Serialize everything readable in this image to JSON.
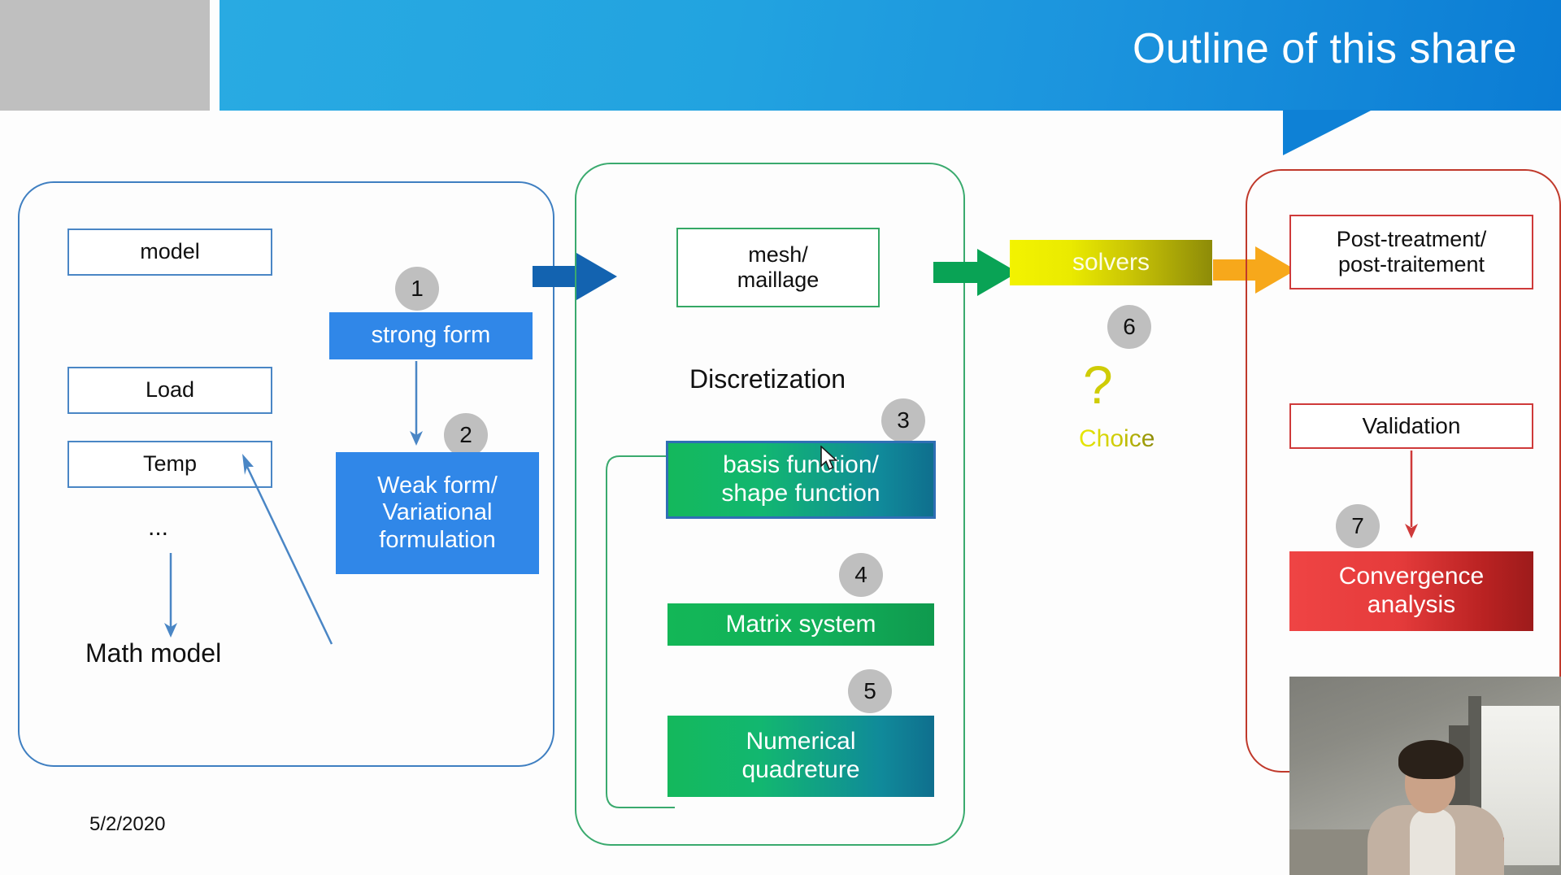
{
  "header": {
    "title": "Outline of this share"
  },
  "footer": {
    "date": "5/2/2020"
  },
  "colors": {
    "header_blue": "#1b93dd",
    "panel_blue": "#3f7fc1",
    "panel_green": "#3aaa6e",
    "panel_red": "#c0392b",
    "fill_blue": "#3087e8",
    "fill_green": "#13b757",
    "fill_yellow": "#eaea00",
    "fill_red": "#e53b3b",
    "badge_gray": "#bfbfbf",
    "selection_blue": "#2f6fb5"
  },
  "left_panel": {
    "inputs": [
      {
        "label": "model"
      },
      {
        "label": "Load"
      },
      {
        "label": "Temp"
      }
    ],
    "ellipsis": "...",
    "math_model": "Math model",
    "steps": [
      {
        "number": "1",
        "label": "strong form"
      },
      {
        "number": "2",
        "label": "Weak form/\nVariational\nformulation"
      }
    ]
  },
  "middle_panel": {
    "mesh": "mesh/\nmaillage",
    "discretization": "Discretization",
    "steps": [
      {
        "number": "3",
        "label": "basis function/\nshape function",
        "selected": true
      },
      {
        "number": "4",
        "label": "Matrix system",
        "selected": false
      },
      {
        "number": "5",
        "label": "Numerical\nquadreture",
        "selected": false
      }
    ]
  },
  "solver_section": {
    "label": "solvers",
    "step_number": "6",
    "question_mark": "?",
    "choice": "Choice"
  },
  "right_panel": {
    "post_treatment": "Post-treatment/\npost-traitement",
    "validation": "Validation",
    "step": {
      "number": "7",
      "label": "Convergence\nanalysis"
    }
  },
  "icons": {
    "arrow_blue": "arrow-right-icon",
    "arrow_green": "arrow-right-icon",
    "arrow_orange": "arrow-right-icon",
    "cursor": "mouse-pointer-icon"
  },
  "webcam": {
    "name": "presenter-video-feed"
  }
}
